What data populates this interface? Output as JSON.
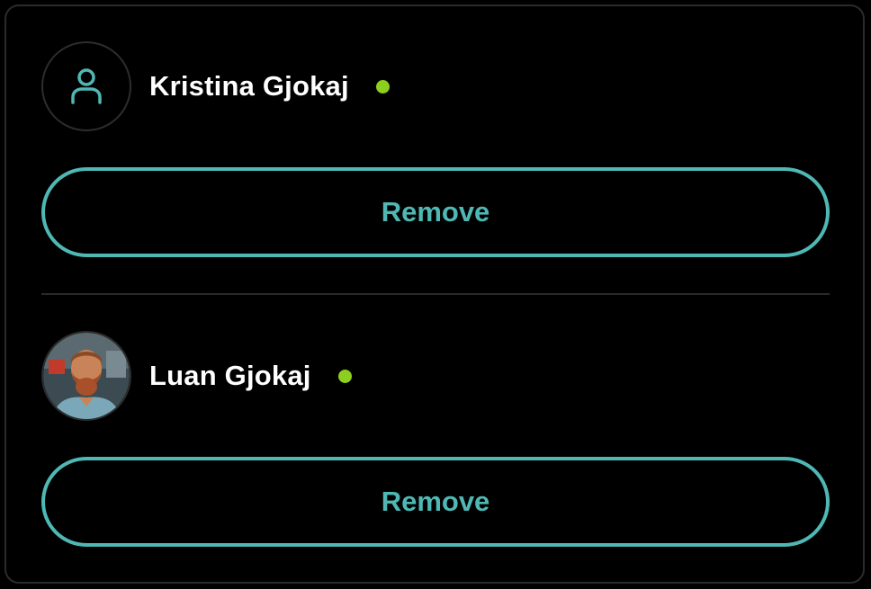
{
  "colors": {
    "accent": "#4fb8b4",
    "online": "#8ccf1e",
    "text": "#ffffff",
    "background": "#000000"
  },
  "members": [
    {
      "name": "Kristina Gjokaj",
      "avatar_icon": "user-icon",
      "status": "online",
      "remove_label": "Remove"
    },
    {
      "name": "Luan Gjokaj",
      "avatar_icon": "photo",
      "status": "online",
      "remove_label": "Remove"
    }
  ]
}
